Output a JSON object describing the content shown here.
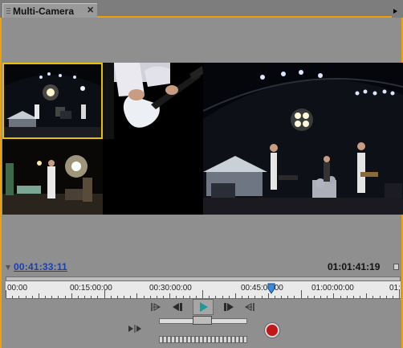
{
  "panel": {
    "title": "Multi-Camera",
    "close_glyph": "✕",
    "menu_icon": "panel-menu-icon"
  },
  "timecode": {
    "current": "00:41:33:11",
    "duration": "01:01:41:19"
  },
  "ruler": {
    "labels": [
      "00:00",
      "00:15:00:00",
      "00:30:00:00",
      "00:45:00:00",
      "01:00:00:00",
      "01:"
    ],
    "playhead_fraction": 0.673
  },
  "cameras": {
    "active": 1,
    "count": 4
  },
  "controls": {
    "go_to_in": "go-to-in-point-icon",
    "step_back": "step-back-icon",
    "play": "play-icon",
    "step_forward": "step-forward-icon",
    "go_to_out": "go-to-out-point-icon",
    "play_in_to_out": "play-in-to-out-icon",
    "record": "record-icon"
  },
  "colors": {
    "active_border": "#e8c000",
    "panel_accent": "#f0a000",
    "timecode_link": "#1a3fb0",
    "play_button": "#1a9a9a",
    "record": "#c01818"
  }
}
